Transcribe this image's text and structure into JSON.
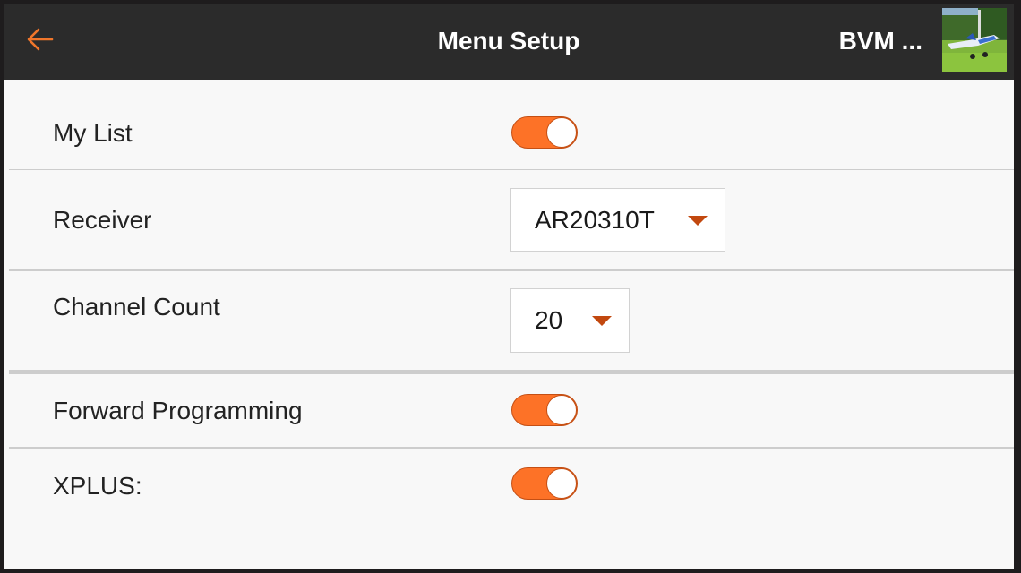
{
  "header": {
    "title": "Menu Setup",
    "model_name": "BVM ...",
    "back_icon": "arrow-left-icon",
    "model_image": "model-thumbnail-airplane"
  },
  "colors": {
    "accent": "#fd7227",
    "header_bg": "#2b2b2b",
    "content_bg": "#f8f8f8",
    "caret": "#c2480f"
  },
  "rows": [
    {
      "label": "My List",
      "control": "toggle",
      "value": true
    },
    {
      "label": "Receiver",
      "control": "dropdown",
      "value": "AR20310T"
    },
    {
      "label": "Channel Count",
      "control": "dropdown",
      "value": "20"
    },
    {
      "label": "Forward Programming",
      "control": "toggle",
      "value": true
    },
    {
      "label": "XPLUS:",
      "control": "toggle",
      "value": true
    }
  ]
}
